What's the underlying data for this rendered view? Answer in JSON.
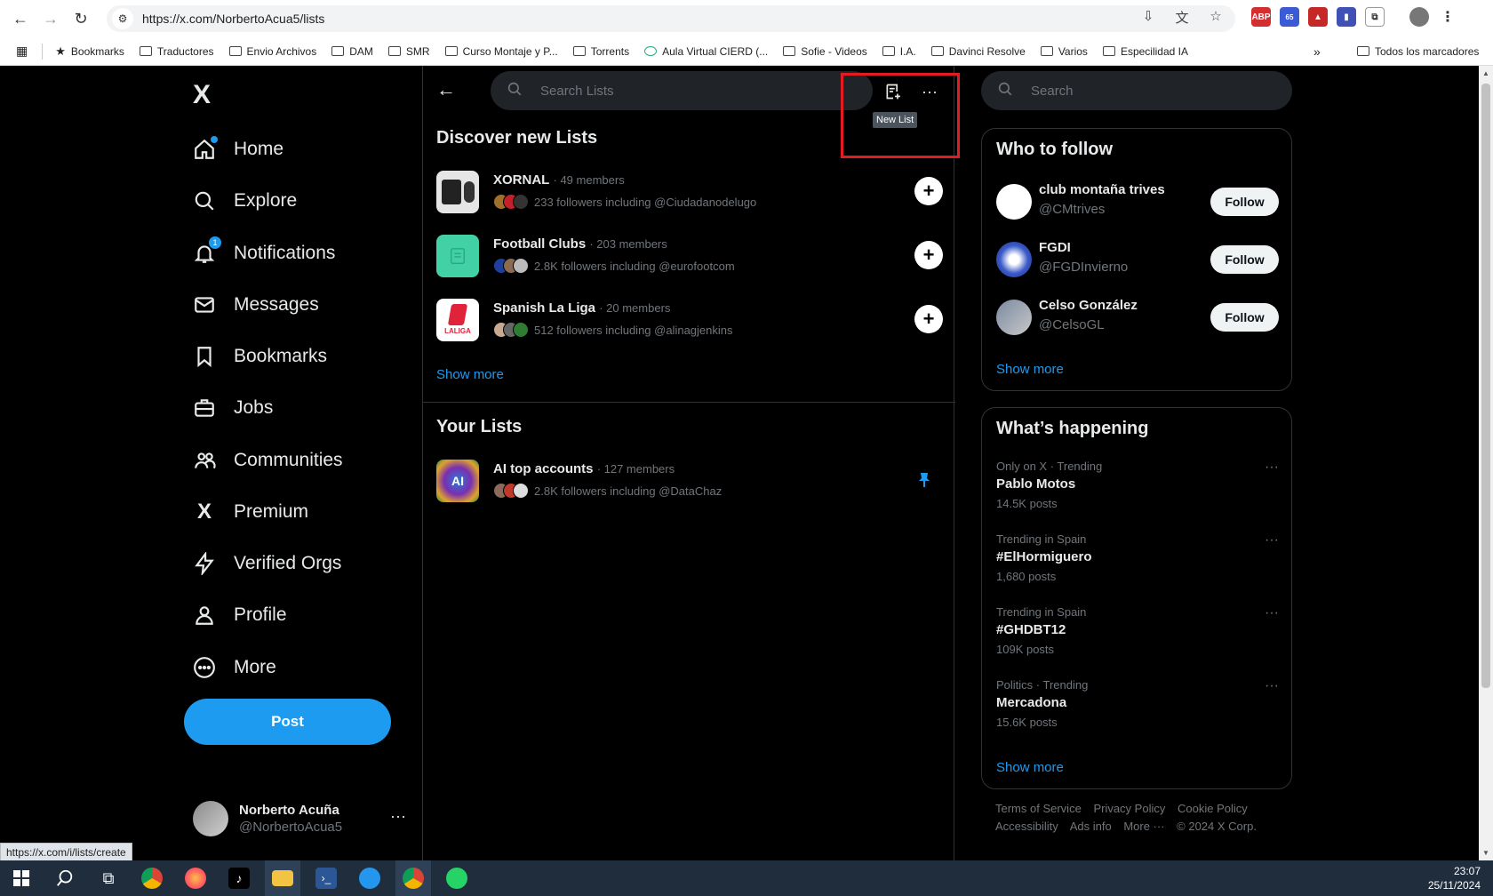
{
  "browser": {
    "url": "https://x.com/NorbertoAcua5/lists",
    "bookmarks": [
      "Bookmarks",
      "Traductores",
      "Envio Archivos",
      "DAM",
      "SMR",
      "Curso Montaje y P...",
      "Torrents",
      "Aula Virtual CIERD (...",
      "Sofie - Videos",
      "I.A.",
      "Davinci Resolve",
      "Varios",
      "Especilidad IA"
    ],
    "all_bookmarks": "Todos los marcadores",
    "extension_badge": "65",
    "abp_label": "ABP"
  },
  "leftnav": {
    "logo": "X",
    "items": [
      {
        "label": "Home",
        "icon": "home-icon"
      },
      {
        "label": "Explore",
        "icon": "search-icon"
      },
      {
        "label": "Notifications",
        "icon": "bell-icon",
        "badge": "1"
      },
      {
        "label": "Messages",
        "icon": "envelope-icon"
      },
      {
        "label": "Bookmarks",
        "icon": "bookmark-icon"
      },
      {
        "label": "Jobs",
        "icon": "briefcase-icon"
      },
      {
        "label": "Communities",
        "icon": "people-icon"
      },
      {
        "label": "Premium",
        "icon": "x-logo-icon"
      },
      {
        "label": "Verified Orgs",
        "icon": "lightning-icon"
      },
      {
        "label": "Profile",
        "icon": "person-icon"
      },
      {
        "label": "More",
        "icon": "more-circle-icon"
      }
    ],
    "post_label": "Post",
    "account": {
      "name": "Norberto Acuña",
      "handle": "@NorbertoAcua5"
    }
  },
  "main": {
    "search_placeholder": "Search Lists",
    "tooltip": "New List",
    "discover_title": "Discover new Lists",
    "discover": [
      {
        "name": "XORNAL",
        "members": "· 49 members",
        "followers": "233 followers including @Ciudadanodelugo"
      },
      {
        "name": "Football Clubs",
        "members": "· 203 members",
        "followers": "2.8K followers including @eurofootcom"
      },
      {
        "name": "Spanish La Liga",
        "members": "· 20 members",
        "followers": "512 followers including @alinagjenkins"
      }
    ],
    "show_more": "Show more",
    "your_lists_title": "Your Lists",
    "your_lists": [
      {
        "name": "AI top accounts",
        "members": "· 127 members",
        "followers": "2.8K followers including @DataChaz",
        "thumb_text": "AI"
      }
    ],
    "laliga_text": "LALIGA"
  },
  "right": {
    "search_placeholder": "Search",
    "who_to_follow_title": "Who to follow",
    "who_to_follow": [
      {
        "name": "club montaña trives",
        "handle": "@CMtrives",
        "button": "Follow"
      },
      {
        "name": "FGDI",
        "handle": "@FGDInvierno",
        "button": "Follow"
      },
      {
        "name": "Celso González",
        "handle": "@CelsoGL",
        "button": "Follow"
      }
    ],
    "wtf_show_more": "Show more",
    "happening_title": "What’s happening",
    "trends": [
      {
        "context": "Only on X · Trending",
        "title": "Pablo Motos",
        "count": "14.5K posts"
      },
      {
        "context": "Trending in Spain",
        "title": "#ElHormiguero",
        "count": "1,680 posts"
      },
      {
        "context": "Trending in Spain",
        "title": "#GHDBT12",
        "count": "109K posts"
      },
      {
        "context": "Politics · Trending",
        "title": "Mercadona",
        "count": "15.6K posts"
      }
    ],
    "happening_show_more": "Show more",
    "footer": [
      "Terms of Service",
      "Privacy Policy",
      "Cookie Policy",
      "Accessibility",
      "Ads info",
      "More ···",
      "© 2024 X Corp."
    ]
  },
  "status_url": "https://x.com/i/lists/create",
  "taskbar": {
    "time": "23:07",
    "date": "25/11/2024"
  },
  "colors": {
    "accent": "#1d9bf0",
    "highlight": "#e41b23",
    "background": "#000000"
  }
}
